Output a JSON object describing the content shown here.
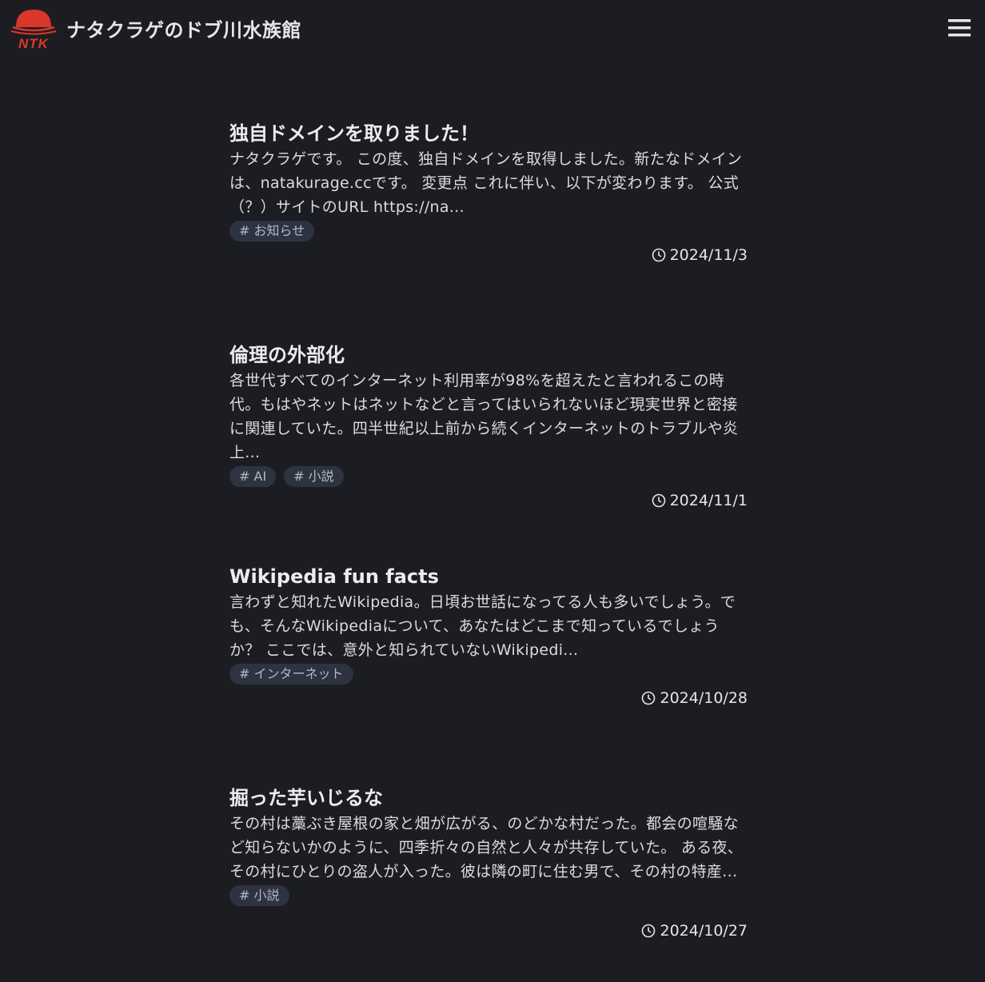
{
  "header": {
    "site_title": "ナタクラゲのドブ川水族館",
    "logo_text": "NTK",
    "logo_color": "#d9372a",
    "menu_icon": "hamburger-menu-icon"
  },
  "posts": [
    {
      "title": "独自ドメインを取りました！",
      "excerpt": "ナタクラゲです。 この度、独自ドメインを取得しました。新たなドメインは、natakurage.ccです。 変更点 これに伴い、以下が変わります。 公式（？）サイトのURL https://na...",
      "tags": [
        "# お知らせ"
      ],
      "date": "2024/11/3"
    },
    {
      "title": "倫理の外部化",
      "excerpt": "各世代すべてのインターネット利用率が98%を超えたと言われるこの時代。もはやネットはネットなどと言ってはいられないほど現実世界と密接に関連していた。四半世紀以上前から続くインターネットのトラブルや炎上...",
      "tags": [
        "# AI",
        "# 小説"
      ],
      "date": "2024/11/1"
    },
    {
      "title": "Wikipedia fun facts",
      "excerpt": "言わずと知れたWikipedia。日頃お世話になってる人も多いでしょう。でも、そんなWikipediaについて、あなたはどこまで知っているでしょうか？ ここでは、意外と知られていないWikipedi...",
      "tags": [
        "# インターネット"
      ],
      "date": "2024/10/28"
    },
    {
      "title": "掘った芋いじるな",
      "excerpt": "その村は藁ぶき屋根の家と畑が広がる、のどかな村だった。都会の喧騒など知らないかのように、四季折々の自然と人々が共存していた。 ある夜、その村にひとりの盗人が入った。彼は隣の町に住む男で、その村の特産...",
      "tags": [
        "# 小説"
      ],
      "date": "2024/10/27"
    }
  ]
}
